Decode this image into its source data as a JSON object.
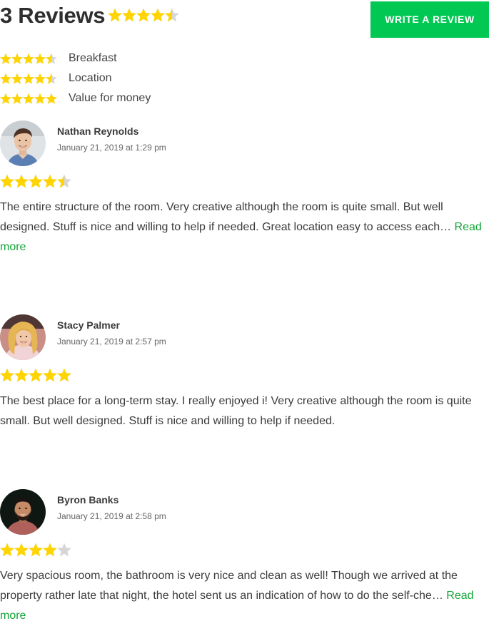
{
  "header": {
    "title": "3 Reviews",
    "rating": 4.5,
    "write_review_label": "WRITE A REVIEW"
  },
  "colors": {
    "star_filled": "#ffd400",
    "star_empty": "#d6d6d6",
    "button_bg": "#00c853",
    "link": "#13a538"
  },
  "categories": [
    {
      "label": "Breakfast",
      "rating": 4.5
    },
    {
      "label": "Location",
      "rating": 4.5
    },
    {
      "label": "Value for money",
      "rating": 5
    }
  ],
  "reviews": [
    {
      "name": "Nathan Reynolds",
      "date": "January 21, 2019 at 1:29 pm",
      "rating": 4.5,
      "text": "The entire structure of the room. Very creative although the room is quite small. But well designed. Stuff is nice and willing to help if needed. Great location easy to access each…",
      "read_more": "Read more",
      "avatar_icon": "avatar-photo-man"
    },
    {
      "name": "Stacy Palmer",
      "date": "January 21, 2019 at 2:57 pm",
      "rating": 5,
      "text": "The best place for a long-term stay. I really enjoyed i! Very creative although the room is quite small. But well designed. Stuff is nice and willing to help if needed.",
      "read_more": "",
      "avatar_icon": "avatar-photo-woman"
    },
    {
      "name": "Byron Banks",
      "date": "January 21, 2019 at 2:58 pm",
      "rating": 4,
      "text": "Very spacious room, the bathroom is very nice and clean as well! Though we arrived at the property rather late that night, the hotel sent us an indication of how to do the self-che…",
      "read_more": "Read more",
      "avatar_icon": "avatar-photo-man-beard"
    }
  ]
}
